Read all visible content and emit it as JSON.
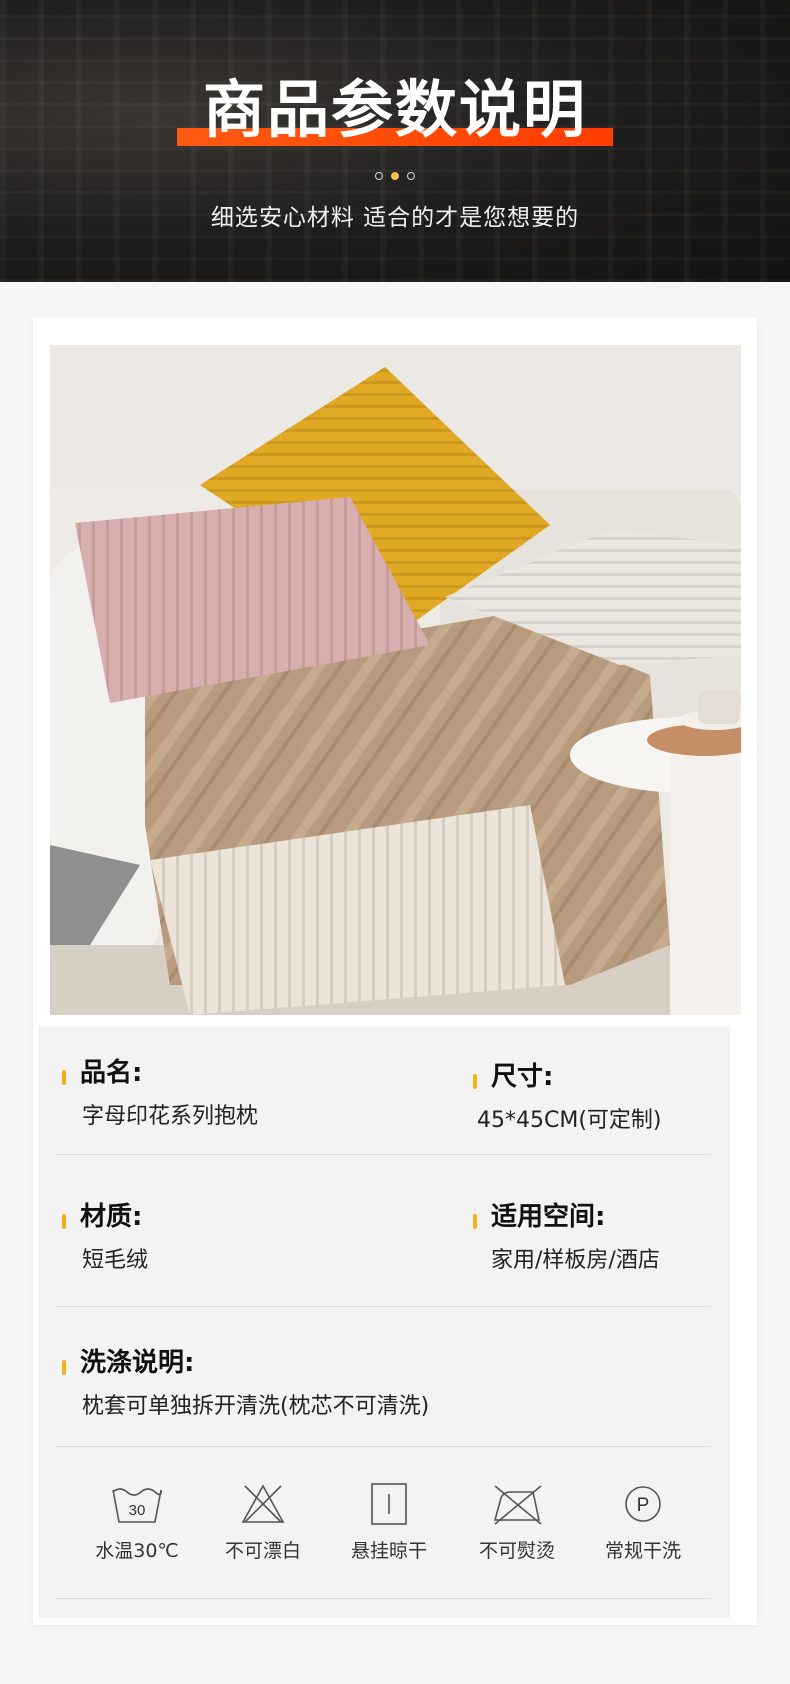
{
  "header": {
    "title": "商品参数说明",
    "subtitle": "细选安心材料 适合的才是您想要的",
    "accent_color": "#ff4d0a",
    "dots": 3,
    "active_dot": 2
  },
  "photo": {
    "description_icon": "product-photo-pillows"
  },
  "specs": {
    "name_label": "品名:",
    "name_value": "字母印花系列抱枕",
    "size_label": "尺寸:",
    "size_value": "45*45CM(可定制)",
    "material_label": "材质:",
    "material_value": "短毛绒",
    "space_label": "适用空间:",
    "space_value": "家用/样板房/酒店",
    "wash_label": "洗涤说明:",
    "wash_value": "枕套可单独拆开清洗(枕芯不可清洗)",
    "marker_color": "#f3b21a"
  },
  "care": [
    {
      "icon": "wash-30-icon",
      "label": "水温30℃",
      "icon_text": "30"
    },
    {
      "icon": "no-bleach-icon",
      "label": "不可漂白"
    },
    {
      "icon": "hang-dry-icon",
      "label": "悬挂晾干"
    },
    {
      "icon": "no-iron-icon",
      "label": "不可熨烫"
    },
    {
      "icon": "dry-clean-icon",
      "label": "常规干洗",
      "icon_text": "P"
    }
  ]
}
